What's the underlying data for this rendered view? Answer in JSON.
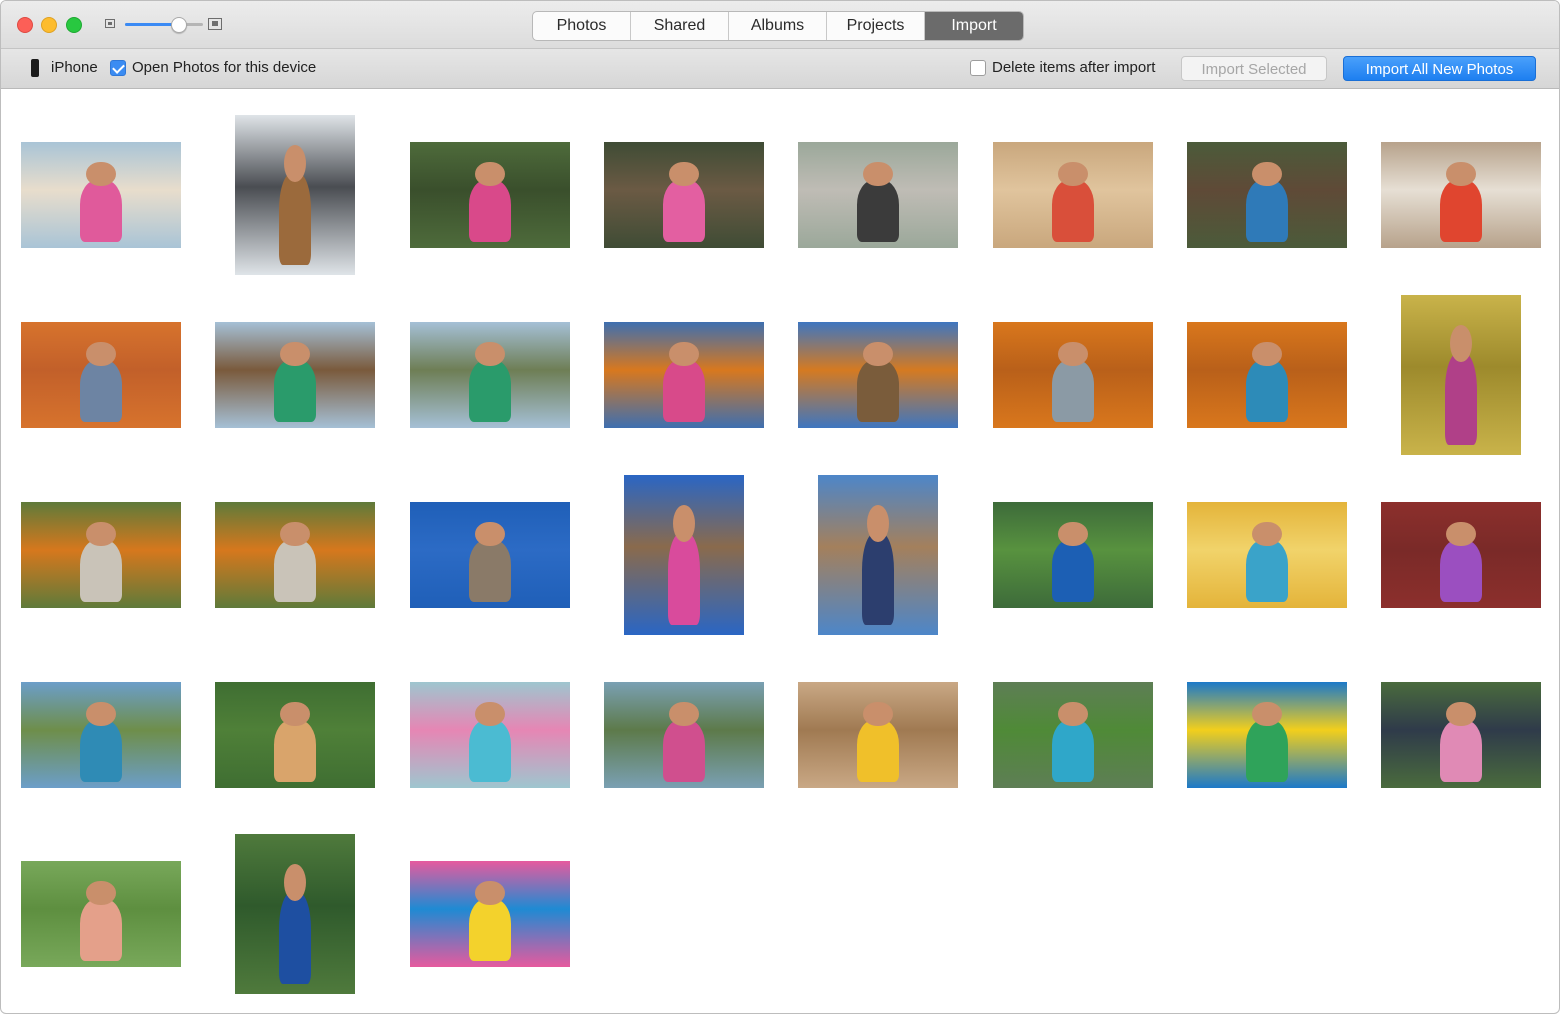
{
  "toolbar_title": {
    "tabs": [
      {
        "label": "Photos",
        "active": false
      },
      {
        "label": "Shared",
        "active": false
      },
      {
        "label": "Albums",
        "active": false
      },
      {
        "label": "Projects",
        "active": false
      },
      {
        "label": "Import",
        "active": true
      }
    ],
    "zoom_level": 0.68
  },
  "import_bar": {
    "device_name": "iPhone",
    "open_photos_label": "Open Photos for this device",
    "open_photos_checked": true,
    "delete_items_label": "Delete items after import",
    "delete_items_checked": false,
    "import_selected_label": "Import Selected",
    "import_all_label": "Import All New Photos"
  },
  "colors": {
    "accent": "#1d7ff0",
    "active_tab": "#6b6b6b"
  },
  "photos": [
    {
      "subject": "beach mother and child",
      "orientation": "landscape",
      "palette": [
        "#a9c4d6",
        "#e8ddcc",
        "#e05a9b"
      ]
    },
    {
      "subject": "kids in car window with teddy bear",
      "orientation": "portrait",
      "palette": [
        "#dfe4e8",
        "#4a4d52",
        "#9b6a3c"
      ]
    },
    {
      "subject": "girls on grass with violin",
      "orientation": "landscape",
      "palette": [
        "#4e6b3b",
        "#3a4f2c",
        "#d9498a"
      ]
    },
    {
      "subject": "kids walking in forest",
      "orientation": "landscape",
      "palette": [
        "#3f4c35",
        "#6b5a44",
        "#e35fa1"
      ]
    },
    {
      "subject": "kids biking on path",
      "orientation": "landscape",
      "palette": [
        "#9ba89a",
        "#bfbcb5",
        "#3b3b3b"
      ]
    },
    {
      "subject": "kids with shaved ice",
      "orientation": "landscape",
      "palette": [
        "#c9a77d",
        "#e0c49d",
        "#d94f3a"
      ]
    },
    {
      "subject": "kids by tree trunk",
      "orientation": "landscape",
      "palette": [
        "#4b5b3a",
        "#5f4a37",
        "#2f7ab8"
      ]
    },
    {
      "subject": "girl with guitar on couch",
      "orientation": "landscape",
      "palette": [
        "#b7a28b",
        "#e6dfd4",
        "#e0452f"
      ]
    },
    {
      "subject": "girl with orange blanket",
      "orientation": "landscape",
      "palette": [
        "#d7732d",
        "#c2602a",
        "#6d84a3"
      ]
    },
    {
      "subject": "girl with hula hoop by fence",
      "orientation": "landscape",
      "palette": [
        "#a5c0d6",
        "#7a5a3c",
        "#2a9b6b"
      ]
    },
    {
      "subject": "girl jumping with hula hoop",
      "orientation": "landscape",
      "palette": [
        "#a5c0d6",
        "#6e7e55",
        "#2a9b6b"
      ]
    },
    {
      "subject": "girl in pumpkin patch",
      "orientation": "landscape",
      "palette": [
        "#3e6fb0",
        "#d8781e",
        "#d84a8a"
      ]
    },
    {
      "subject": "family in pumpkin patch",
      "orientation": "landscape",
      "palette": [
        "#3e76c0",
        "#d57a21",
        "#7a5c3b"
      ]
    },
    {
      "subject": "boy lying on pumpkins",
      "orientation": "landscape",
      "palette": [
        "#d9771c",
        "#b9601a",
        "#8b9aa5"
      ]
    },
    {
      "subject": "girl lying on pumpkins",
      "orientation": "landscape",
      "palette": [
        "#d9771c",
        "#b9601a",
        "#2d8bb8"
      ]
    },
    {
      "subject": "girl in corn field",
      "orientation": "portrait",
      "palette": [
        "#c9b34a",
        "#9d8a2c",
        "#b04088"
      ]
    },
    {
      "subject": "mother and girl with pumpkins",
      "orientation": "landscape",
      "palette": [
        "#5f7a3a",
        "#d6781d",
        "#c9c3b8"
      ]
    },
    {
      "subject": "mother and girls with pumpkins",
      "orientation": "landscape",
      "palette": [
        "#5f7a3a",
        "#d6781d",
        "#c9c3b8"
      ]
    },
    {
      "subject": "boy jumping on plank",
      "orientation": "landscape",
      "palette": [
        "#1f5fb8",
        "#2c6bc5",
        "#8a7a68"
      ]
    },
    {
      "subject": "girl with kite",
      "orientation": "portrait",
      "palette": [
        "#2a66c4",
        "#8a6a4c",
        "#d94b9c"
      ]
    },
    {
      "subject": "girl on beach cliffs",
      "orientation": "portrait",
      "palette": [
        "#4d86c9",
        "#a4805c",
        "#2c3e6e"
      ]
    },
    {
      "subject": "boy kicking soccer ball",
      "orientation": "landscape",
      "palette": [
        "#3d6b3a",
        "#58923f",
        "#1c5fb4"
      ]
    },
    {
      "subject": "girl with pigtails",
      "orientation": "landscape",
      "palette": [
        "#e4b43a",
        "#f1d36a",
        "#3aa3c9"
      ]
    },
    {
      "subject": "two girls on porch",
      "orientation": "landscape",
      "palette": [
        "#8c2f2c",
        "#7a2a28",
        "#9b4fc0"
      ]
    },
    {
      "subject": "siblings on hill",
      "orientation": "landscape",
      "palette": [
        "#6c9ec9",
        "#6e8e4a",
        "#2f8bb5"
      ]
    },
    {
      "subject": "girl hugging puppy",
      "orientation": "landscape",
      "palette": [
        "#3f6e32",
        "#4f8038",
        "#d9a46b"
      ]
    },
    {
      "subject": "mother and daughter at party",
      "orientation": "landscape",
      "palette": [
        "#9ec6cf",
        "#e686b4",
        "#4bbbd2"
      ]
    },
    {
      "subject": "girl with party hat",
      "orientation": "landscape",
      "palette": [
        "#7aa0b3",
        "#5d7a4a",
        "#d04f8e"
      ]
    },
    {
      "subject": "three kids on bench",
      "orientation": "landscape",
      "palette": [
        "#c9a885",
        "#a07a52",
        "#f0c02a"
      ]
    },
    {
      "subject": "kids running on lawn",
      "orientation": "landscape",
      "palette": [
        "#5e7e55",
        "#4f8a37",
        "#2fa7c9"
      ]
    },
    {
      "subject": "girl with balloons",
      "orientation": "landscape",
      "palette": [
        "#1c79c9",
        "#f2cf1c",
        "#2fa35a"
      ]
    },
    {
      "subject": "girls at party table",
      "orientation": "landscape",
      "palette": [
        "#4a6b3d",
        "#2f3b4a",
        "#e08ab5"
      ]
    },
    {
      "subject": "girl with flowers",
      "orientation": "landscape",
      "palette": [
        "#78a85a",
        "#5e8f40",
        "#e4a08a"
      ]
    },
    {
      "subject": "boy with medal and soccer ball",
      "orientation": "portrait",
      "palette": [
        "#4f7a3c",
        "#2f5a2c",
        "#1e4fa1"
      ]
    },
    {
      "subject": "girl with balloons close-up",
      "orientation": "landscape",
      "palette": [
        "#e65a9e",
        "#1f8ad3",
        "#f3d22c"
      ]
    }
  ]
}
